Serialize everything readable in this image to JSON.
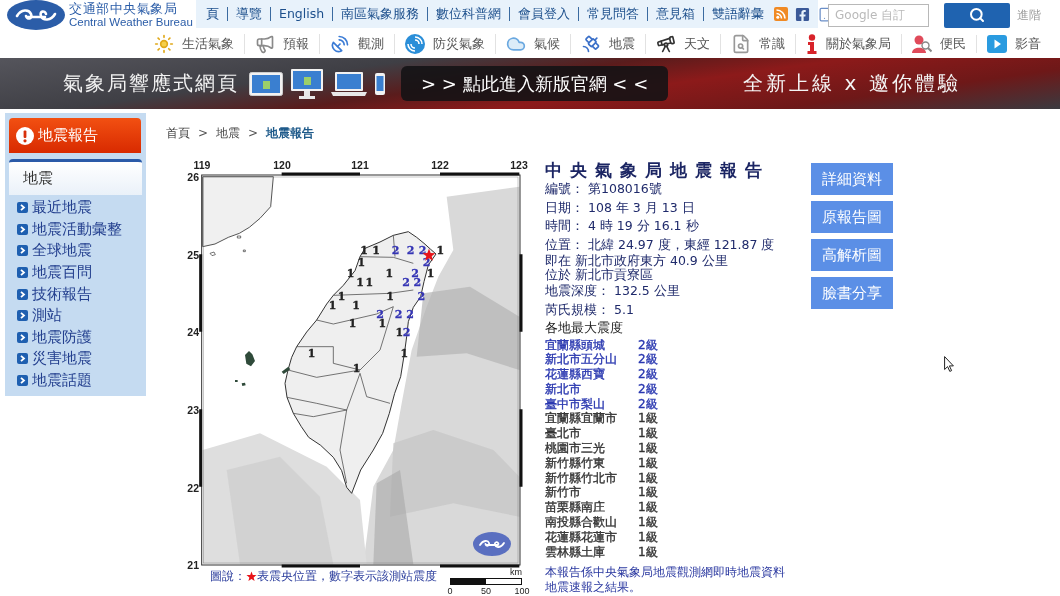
{
  "header": {
    "logo": {
      "title": "交通部中央氣象局",
      "subtitle": "Central Weather Bureau"
    },
    "links": [
      "頁",
      "導覽",
      "English",
      "南區氣象服務",
      "數位科普網",
      "會員登入",
      "常見問答",
      "意見箱",
      "雙語辭彙"
    ],
    "search": {
      "placeholder": "Google 自訂"
    },
    "advanced_link": "進階"
  },
  "nav": [
    "生活氣象",
    "預報",
    "觀測",
    "防災氣象",
    "氣候",
    "地震",
    "天文",
    "常識",
    "關於氣象局",
    "便民",
    "影音"
  ],
  "banner": {
    "title": "氣象局響應式網頁",
    "cta": "> > 點此進入新版官網 < <",
    "slogan": "全新上線 x 邀你體驗"
  },
  "sidebar": {
    "button": "地震報告",
    "section": "地震",
    "items": [
      "最近地震",
      "地震活動彙整",
      "全球地震",
      "地震百問",
      "技術報告",
      "測站",
      "地震防護",
      "災害地震",
      "地震話題"
    ]
  },
  "breadcrumb": {
    "separator": ">",
    "items": [
      {
        "label": "首頁",
        "selected": false
      },
      {
        "label": "地震",
        "selected": false
      },
      {
        "label": "地震報告",
        "selected": true
      }
    ]
  },
  "map": {
    "x_ticks": [
      "119",
      "120",
      "121",
      "122",
      "123"
    ],
    "y_ticks": [
      "26",
      "25",
      "24",
      "23",
      "22",
      "21"
    ],
    "intensity_marks": [
      {
        "value": "1",
        "color": "#222222"
      },
      {
        "value": "1",
        "color": "#222222"
      },
      {
        "value": "2",
        "color": "#3535b5"
      },
      {
        "value": "2",
        "color": "#3535b5"
      },
      {
        "value": "2",
        "color": "#3535b5"
      },
      {
        "value": "1",
        "color": "#222222"
      },
      {
        "value": "1",
        "color": "#222222"
      },
      {
        "value": "2",
        "color": "#3535b5"
      },
      {
        "value": "1",
        "color": "#222222"
      },
      {
        "value": "1",
        "color": "#222222"
      },
      {
        "value": "2",
        "color": "#3535b5"
      },
      {
        "value": "1",
        "color": "#222222"
      },
      {
        "value": "1",
        "color": "#222222"
      },
      {
        "value": "1",
        "color": "#222222"
      },
      {
        "value": "2",
        "color": "#3535b5"
      },
      {
        "value": "2",
        "color": "#3535b5"
      },
      {
        "value": "1",
        "color": "#222222"
      },
      {
        "value": "1",
        "color": "#222222"
      },
      {
        "value": "2",
        "color": "#3535b5"
      },
      {
        "value": "1",
        "color": "#222222"
      },
      {
        "value": "1",
        "color": "#222222"
      },
      {
        "value": "2",
        "color": "#3535b5"
      },
      {
        "value": "2",
        "color": "#3535b5"
      },
      {
        "value": "2",
        "color": "#3535b5"
      },
      {
        "value": "1",
        "color": "#222222"
      },
      {
        "value": "1",
        "color": "#222222"
      },
      {
        "value": "1",
        "color": "#222222"
      },
      {
        "value": "2",
        "color": "#3535b5"
      },
      {
        "value": "1",
        "color": "#222222"
      },
      {
        "value": "1",
        "color": "#222222"
      },
      {
        "value": "1",
        "color": "#222222"
      }
    ],
    "legend": {
      "label": "圖說：",
      "text": "表震央位置，數字表示該測站震度"
    },
    "scale": {
      "unit": "km",
      "labels": [
        "0",
        "50",
        "100"
      ]
    }
  },
  "report": {
    "title": "中央氣象局地震報告",
    "lines": [
      {
        "kind": "field",
        "text": "編號： 第108016號"
      },
      {
        "kind": "field",
        "text": "日期： 108 年 3 月 13 日"
      },
      {
        "kind": "field",
        "text": "時間： 4 時 19 分 16.1 秒"
      },
      {
        "kind": "field",
        "text": "位置： 北緯 24.97 度，東經 121.87 度"
      },
      {
        "kind": "continuation",
        "text": "即在 新北市政府東方 40.9 公里"
      },
      {
        "kind": "continuation",
        "text": "位於 新北市貢寮區"
      },
      {
        "kind": "field",
        "text": "地震深度： 132.5 公里"
      },
      {
        "kind": "field",
        "text": "芮氏規模： 5.1"
      }
    ],
    "intensity_heading": "各地最大震度",
    "intensities": [
      {
        "station": "宜蘭縣頭城",
        "intensity": "2級",
        "color": "#2a38b0"
      },
      {
        "station": "新北市五分山",
        "intensity": "2級",
        "color": "#2a38b0"
      },
      {
        "station": "花蓮縣西寶",
        "intensity": "2級",
        "color": "#2a38b0"
      },
      {
        "station": "新北市",
        "intensity": "2級",
        "color": "#2a38b0"
      },
      {
        "station": "臺中市梨山",
        "intensity": "2級",
        "color": "#2a38b0"
      },
      {
        "station": "宜蘭縣宜蘭市",
        "intensity": "1級",
        "color": "#333333"
      },
      {
        "station": "臺北市",
        "intensity": "1級",
        "color": "#333333"
      },
      {
        "station": "桃園市三光",
        "intensity": "1級",
        "color": "#333333"
      },
      {
        "station": "新竹縣竹東",
        "intensity": "1級",
        "color": "#333333"
      },
      {
        "station": "新竹縣竹北市",
        "intensity": "1級",
        "color": "#333333"
      },
      {
        "station": "新竹市",
        "intensity": "1級",
        "color": "#333333"
      },
      {
        "station": "苗栗縣南庄",
        "intensity": "1級",
        "color": "#333333"
      },
      {
        "station": "南投縣合歡山",
        "intensity": "1級",
        "color": "#333333"
      },
      {
        "station": "花蓮縣花蓮市",
        "intensity": "1級",
        "color": "#333333"
      },
      {
        "station": "雲林縣土庫",
        "intensity": "1級",
        "color": "#333333"
      }
    ],
    "note": "本報告係中央氣象局地震觀測網即時地震資料地震速報之結果。"
  },
  "buttons": [
    "詳細資料",
    "原報告圖",
    "高解析圖",
    "臉書分享"
  ]
}
